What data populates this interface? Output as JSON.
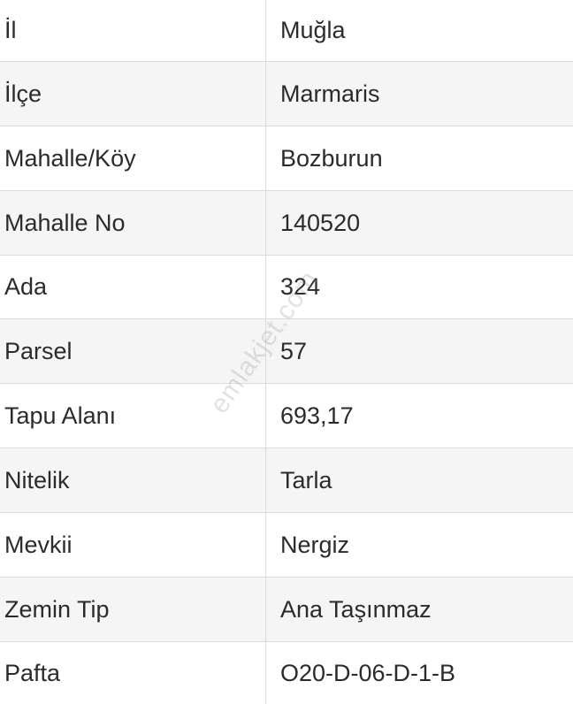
{
  "rows": [
    {
      "label": "İl",
      "value": "Muğla"
    },
    {
      "label": "İlçe",
      "value": "Marmaris"
    },
    {
      "label": "Mahalle/Köy",
      "value": "Bozburun"
    },
    {
      "label": "Mahalle No",
      "value": "140520"
    },
    {
      "label": "Ada",
      "value": "324"
    },
    {
      "label": "Parsel",
      "value": "57"
    },
    {
      "label": "Tapu Alanı",
      "value": "693,17"
    },
    {
      "label": "Nitelik",
      "value": "Tarla"
    },
    {
      "label": "Mevkii",
      "value": "Nergiz"
    },
    {
      "label": "Zemin Tip",
      "value": "Ana Taşınmaz"
    },
    {
      "label": "Pafta",
      "value": "O20-D-06-D-1-B"
    }
  ],
  "watermark": "emlakjet.com",
  "colors": {
    "row_alt": "#f5f5f5",
    "row_plain": "#ffffff",
    "border": "#dcdcdc",
    "text": "#2b2b2b"
  }
}
